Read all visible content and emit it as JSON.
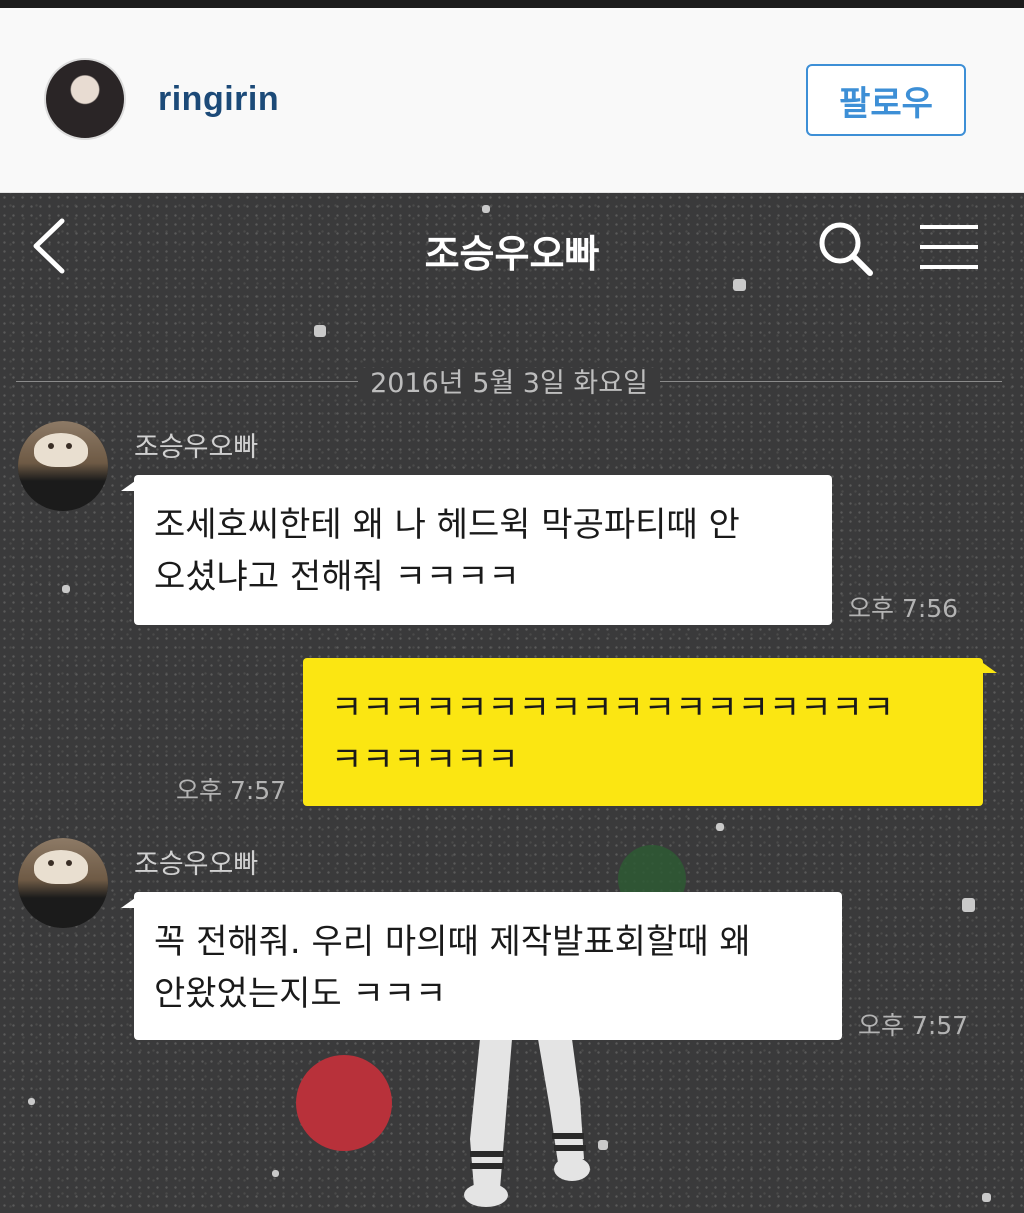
{
  "instagram": {
    "username": "ringirin",
    "follow_label": "팔로우"
  },
  "chat": {
    "title": "조승우오빠",
    "date_divider": "2016년 5월 3일 화요일",
    "messages": [
      {
        "sender": "조승우오빠",
        "lines": [
          "조세호씨한테 왜 나 헤드윅 막공파티때 안",
          "오셨냐고 전해줘 ㅋㅋㅋㅋ"
        ],
        "time": "오후 7:56"
      },
      {
        "sender": "me",
        "lines": [
          "ㅋㅋㅋㅋㅋㅋㅋㅋㅋㅋㅋㅋㅋㅋㅋㅋㅋㅋ",
          "ㅋㅋㅋㅋㅋㅋ"
        ],
        "time": "오후 7:57"
      },
      {
        "sender": "조승우오빠",
        "lines": [
          "꼭 전해줘. 우리 마의때 제작발표회할때 왜",
          "안왔었는지도 ㅋㅋㅋ"
        ],
        "time": "오후 7:57"
      }
    ]
  },
  "icons": {
    "back": "back-arrow-icon",
    "search": "search-icon",
    "menu": "hamburger-menu-icon"
  },
  "colors": {
    "chat_background": "#3a3a3b",
    "my_bubble": "#fbe612",
    "friend_bubble": "#ffffff",
    "follow_accent": "#3d8fd6",
    "username": "#1c4a78"
  }
}
